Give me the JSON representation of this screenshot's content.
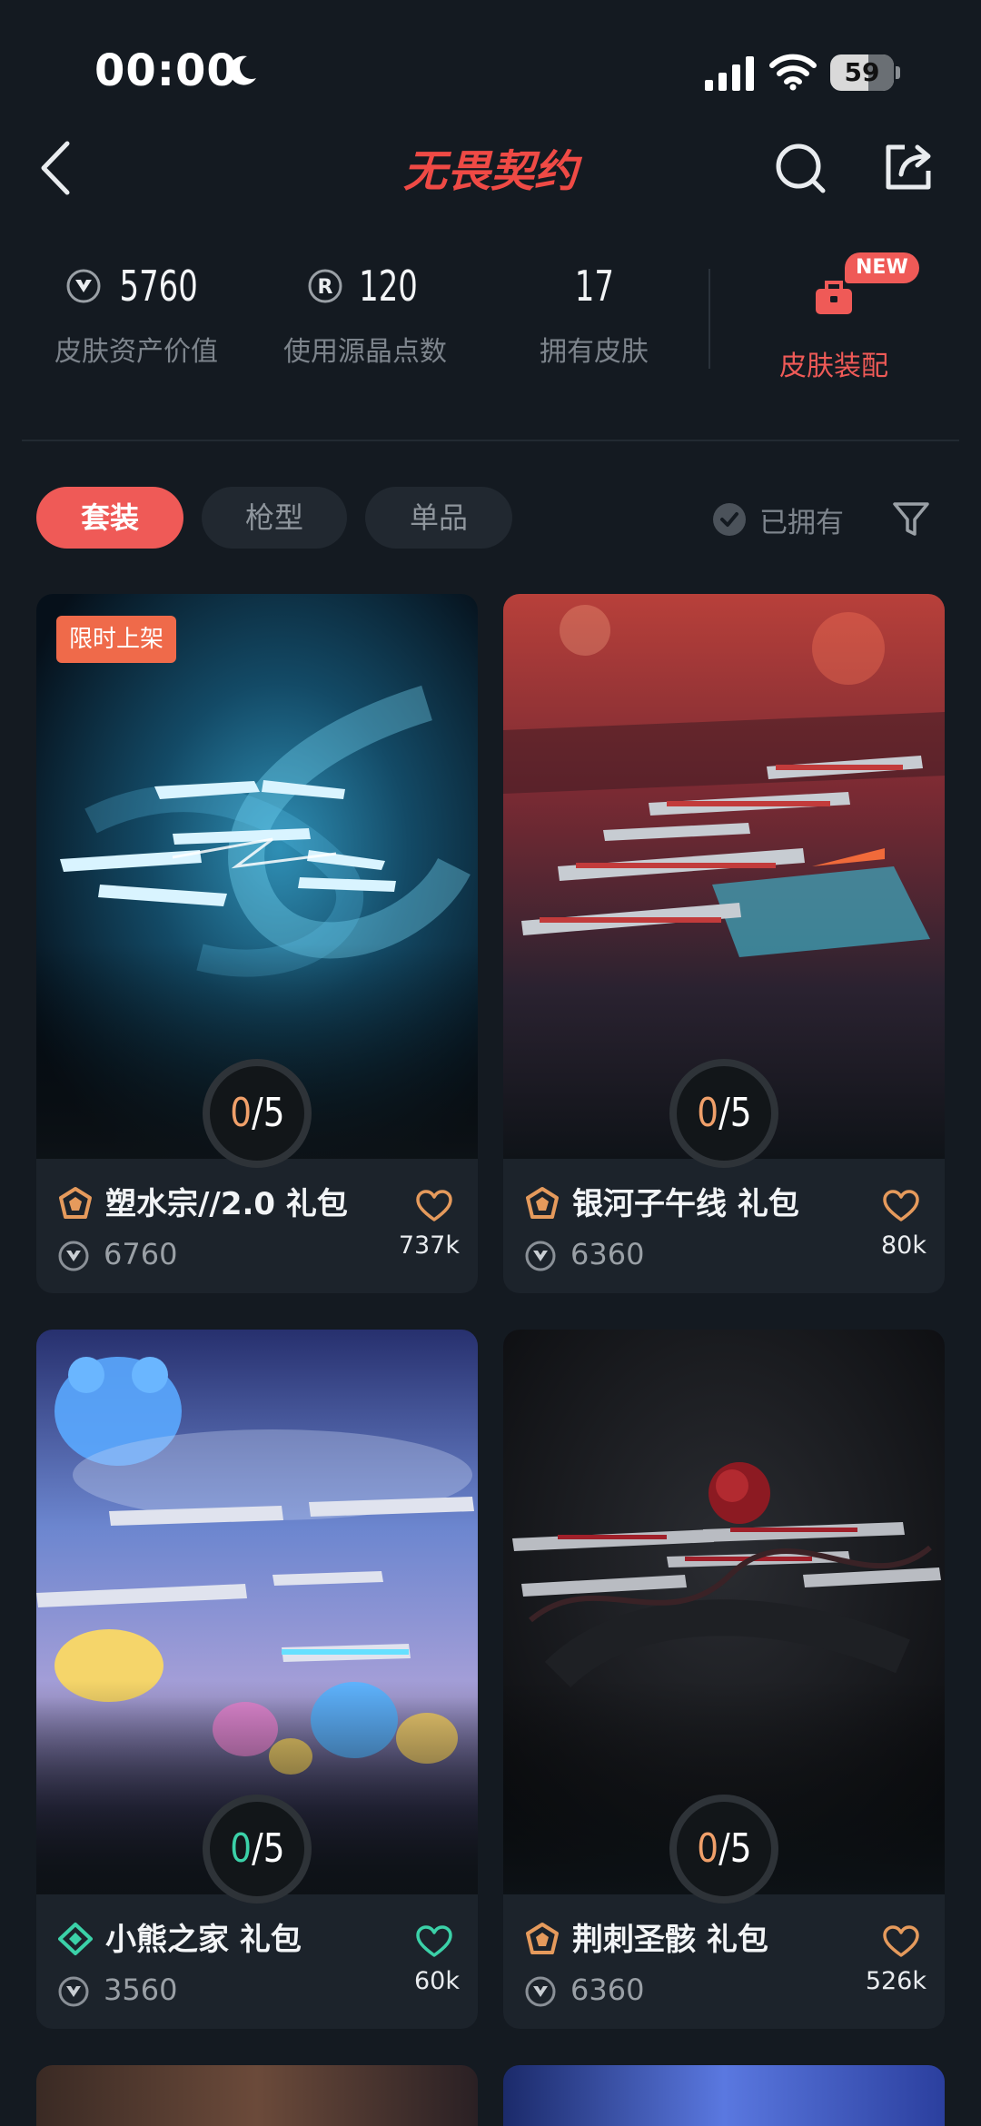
{
  "status_bar": {
    "time": "00:00",
    "battery": "59"
  },
  "header": {
    "app_title": "无畏契约"
  },
  "stats": [
    {
      "value": "5760",
      "label": "皮肤资产价值",
      "icon": "vp-coin-icon"
    },
    {
      "value": "120",
      "label": "使用源晶点数",
      "icon": "radianite-icon"
    },
    {
      "value": "17",
      "label": "拥有皮肤",
      "icon": ""
    }
  ],
  "equip": {
    "label": "皮肤装配",
    "badge": "NEW"
  },
  "filters": {
    "tabs": [
      {
        "label": "套装",
        "active": true
      },
      {
        "label": "枪型",
        "active": false
      },
      {
        "label": "单品",
        "active": false
      }
    ],
    "owned_label": "已拥有"
  },
  "cards": [
    {
      "title": "塑水宗//2.0 礼包",
      "price": "6760",
      "likes": "737k",
      "progress_owned": "0",
      "progress_total": "/5",
      "badge": "限时上架",
      "tier_color": "#e59a5c"
    },
    {
      "title": "银河子午线 礼包",
      "price": "6360",
      "likes": "80k",
      "progress_owned": "0",
      "progress_total": "/5",
      "badge": "",
      "tier_color": "#e59a5c"
    },
    {
      "title": "小熊之家 礼包",
      "price": "3560",
      "likes": "60k",
      "progress_owned": "0",
      "progress_total": "/5",
      "badge": "",
      "tier_color": "#3bd1a8"
    },
    {
      "title": "荆刺圣骸 礼包",
      "price": "6360",
      "likes": "526k",
      "progress_owned": "0",
      "progress_total": "/5",
      "badge": "",
      "tier_color": "#e59a5c"
    }
  ],
  "colors": {
    "accent": "#ef5a57",
    "background": "#141a21",
    "card": "#1c232b",
    "premium_tier": "#e59a5c",
    "deluxe_tier": "#3bd1a8"
  }
}
